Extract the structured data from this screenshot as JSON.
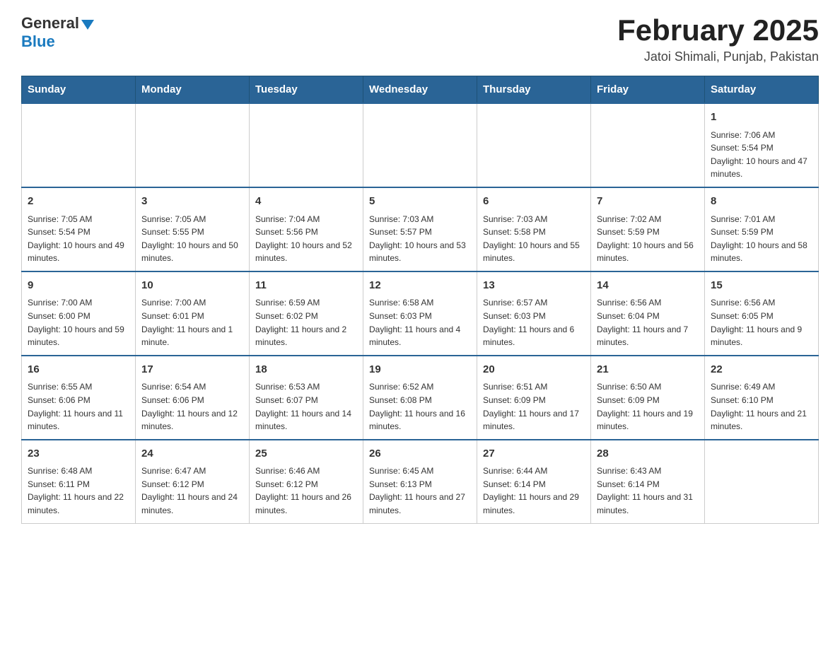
{
  "header": {
    "logo": {
      "general": "General",
      "blue": "Blue"
    },
    "title": "February 2025",
    "subtitle": "Jatoi Shimali, Punjab, Pakistan"
  },
  "calendar": {
    "days_of_week": [
      "Sunday",
      "Monday",
      "Tuesday",
      "Wednesday",
      "Thursday",
      "Friday",
      "Saturday"
    ],
    "weeks": [
      [
        {
          "day": "",
          "info": ""
        },
        {
          "day": "",
          "info": ""
        },
        {
          "day": "",
          "info": ""
        },
        {
          "day": "",
          "info": ""
        },
        {
          "day": "",
          "info": ""
        },
        {
          "day": "",
          "info": ""
        },
        {
          "day": "1",
          "info": "Sunrise: 7:06 AM\nSunset: 5:54 PM\nDaylight: 10 hours and 47 minutes."
        }
      ],
      [
        {
          "day": "2",
          "info": "Sunrise: 7:05 AM\nSunset: 5:54 PM\nDaylight: 10 hours and 49 minutes."
        },
        {
          "day": "3",
          "info": "Sunrise: 7:05 AM\nSunset: 5:55 PM\nDaylight: 10 hours and 50 minutes."
        },
        {
          "day": "4",
          "info": "Sunrise: 7:04 AM\nSunset: 5:56 PM\nDaylight: 10 hours and 52 minutes."
        },
        {
          "day": "5",
          "info": "Sunrise: 7:03 AM\nSunset: 5:57 PM\nDaylight: 10 hours and 53 minutes."
        },
        {
          "day": "6",
          "info": "Sunrise: 7:03 AM\nSunset: 5:58 PM\nDaylight: 10 hours and 55 minutes."
        },
        {
          "day": "7",
          "info": "Sunrise: 7:02 AM\nSunset: 5:59 PM\nDaylight: 10 hours and 56 minutes."
        },
        {
          "day": "8",
          "info": "Sunrise: 7:01 AM\nSunset: 5:59 PM\nDaylight: 10 hours and 58 minutes."
        }
      ],
      [
        {
          "day": "9",
          "info": "Sunrise: 7:00 AM\nSunset: 6:00 PM\nDaylight: 10 hours and 59 minutes."
        },
        {
          "day": "10",
          "info": "Sunrise: 7:00 AM\nSunset: 6:01 PM\nDaylight: 11 hours and 1 minute."
        },
        {
          "day": "11",
          "info": "Sunrise: 6:59 AM\nSunset: 6:02 PM\nDaylight: 11 hours and 2 minutes."
        },
        {
          "day": "12",
          "info": "Sunrise: 6:58 AM\nSunset: 6:03 PM\nDaylight: 11 hours and 4 minutes."
        },
        {
          "day": "13",
          "info": "Sunrise: 6:57 AM\nSunset: 6:03 PM\nDaylight: 11 hours and 6 minutes."
        },
        {
          "day": "14",
          "info": "Sunrise: 6:56 AM\nSunset: 6:04 PM\nDaylight: 11 hours and 7 minutes."
        },
        {
          "day": "15",
          "info": "Sunrise: 6:56 AM\nSunset: 6:05 PM\nDaylight: 11 hours and 9 minutes."
        }
      ],
      [
        {
          "day": "16",
          "info": "Sunrise: 6:55 AM\nSunset: 6:06 PM\nDaylight: 11 hours and 11 minutes."
        },
        {
          "day": "17",
          "info": "Sunrise: 6:54 AM\nSunset: 6:06 PM\nDaylight: 11 hours and 12 minutes."
        },
        {
          "day": "18",
          "info": "Sunrise: 6:53 AM\nSunset: 6:07 PM\nDaylight: 11 hours and 14 minutes."
        },
        {
          "day": "19",
          "info": "Sunrise: 6:52 AM\nSunset: 6:08 PM\nDaylight: 11 hours and 16 minutes."
        },
        {
          "day": "20",
          "info": "Sunrise: 6:51 AM\nSunset: 6:09 PM\nDaylight: 11 hours and 17 minutes."
        },
        {
          "day": "21",
          "info": "Sunrise: 6:50 AM\nSunset: 6:09 PM\nDaylight: 11 hours and 19 minutes."
        },
        {
          "day": "22",
          "info": "Sunrise: 6:49 AM\nSunset: 6:10 PM\nDaylight: 11 hours and 21 minutes."
        }
      ],
      [
        {
          "day": "23",
          "info": "Sunrise: 6:48 AM\nSunset: 6:11 PM\nDaylight: 11 hours and 22 minutes."
        },
        {
          "day": "24",
          "info": "Sunrise: 6:47 AM\nSunset: 6:12 PM\nDaylight: 11 hours and 24 minutes."
        },
        {
          "day": "25",
          "info": "Sunrise: 6:46 AM\nSunset: 6:12 PM\nDaylight: 11 hours and 26 minutes."
        },
        {
          "day": "26",
          "info": "Sunrise: 6:45 AM\nSunset: 6:13 PM\nDaylight: 11 hours and 27 minutes."
        },
        {
          "day": "27",
          "info": "Sunrise: 6:44 AM\nSunset: 6:14 PM\nDaylight: 11 hours and 29 minutes."
        },
        {
          "day": "28",
          "info": "Sunrise: 6:43 AM\nSunset: 6:14 PM\nDaylight: 11 hours and 31 minutes."
        },
        {
          "day": "",
          "info": ""
        }
      ]
    ]
  }
}
